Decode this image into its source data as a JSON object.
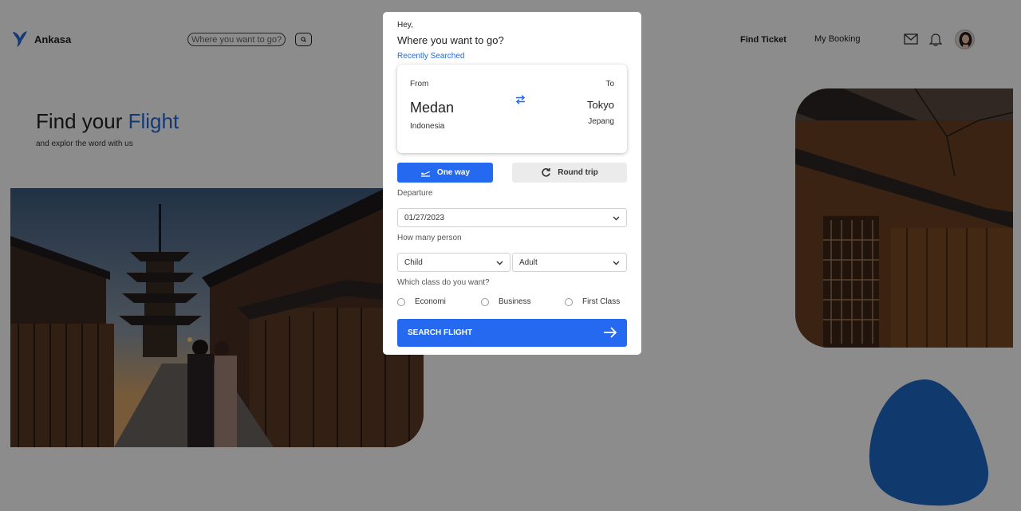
{
  "header": {
    "brand": "Ankasa",
    "search_placeholder": "Where you want to go?",
    "nav": {
      "find_ticket": "Find Ticket",
      "my_booking": "My Booking"
    },
    "icons": [
      "plane-logo-icon",
      "search-icon",
      "mail-icon",
      "bell-icon",
      "avatar"
    ]
  },
  "hero": {
    "title_main": "Find your",
    "title_accent": "Flight",
    "subtitle": "and explor the word with us"
  },
  "modal": {
    "greeting": "Hey,",
    "question": "Where you want to go?",
    "recent_link": "Recently Searched",
    "route": {
      "from_label": "From",
      "from_city": "Medan",
      "from_country": "Indonesia",
      "to_label": "To",
      "to_city": "Tokyo",
      "to_country": "Jepang"
    },
    "trip_type": {
      "one_way": "One way",
      "round_trip": "Round trip",
      "selected": "One way"
    },
    "departure_label": "Departure",
    "departure_date": "01/27/2023",
    "person_label": "How many person",
    "child_value": "Child",
    "adult_value": "Adult",
    "class_label": "Which class do you want?",
    "classes": [
      "Economi",
      "Business",
      "First Class"
    ],
    "search_button": "SEARCH FLIGHT"
  },
  "colors": {
    "accent": "#2469f0",
    "overlay": "rgba(0,0,0,0.45)",
    "blob": "#1e68c8"
  }
}
